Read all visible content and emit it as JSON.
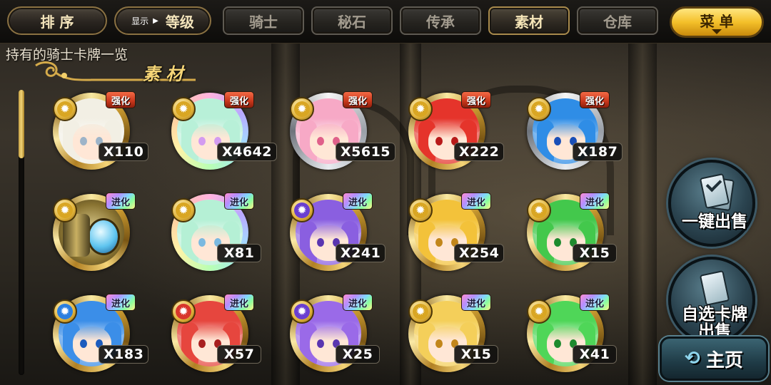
{
  "toolbar": {
    "sort_label": "排 序",
    "display_prefix": "显示",
    "display_value": "等级",
    "menu_label": "菜 单"
  },
  "tabs": [
    {
      "label": "骑士",
      "active": false
    },
    {
      "label": "秘石",
      "active": false
    },
    {
      "label": "传承",
      "active": false
    },
    {
      "label": "素材",
      "active": true
    },
    {
      "label": "仓库",
      "active": false
    }
  ],
  "page_title": "持有的骑士卡牌一览",
  "category_label": "素 材",
  "badges": {
    "strengthen": "强化",
    "evolve": "进化"
  },
  "cards": [
    {
      "badge": "强化",
      "count": "X110",
      "element": "light",
      "hair": "#f2efe4",
      "eye": "#9db4c8",
      "ring": "gold"
    },
    {
      "badge": "强化",
      "count": "X4642",
      "element": "light",
      "hair": "#b8f0d8",
      "eye": "#d39bf0",
      "ring": "rainbow"
    },
    {
      "badge": "强化",
      "count": "X5615",
      "element": "light",
      "hair": "#f7a9c6",
      "eye": "#e0608a",
      "ring": "silver"
    },
    {
      "badge": "强化",
      "count": "X222",
      "element": "light",
      "hair": "#e5342b",
      "eye": "#b81a1a",
      "ring": "gold"
    },
    {
      "badge": "强化",
      "count": "X187",
      "element": "light",
      "hair": "#2f8de6",
      "eye": "#1a4fb8",
      "ring": "silver"
    },
    {
      "badge": "进化",
      "count": "",
      "element": "light",
      "hair": "#6d5a2a",
      "eye": "#6fc7ee",
      "ring": "gold",
      "item": true
    },
    {
      "badge": "进化",
      "count": "X81",
      "element": "light",
      "hair": "#b5f0d5",
      "eye": "#7bb9e0",
      "ring": "rainbow"
    },
    {
      "badge": "进化",
      "count": "X241",
      "element": "dark",
      "hair": "#8a5fe0",
      "eye": "#5a36b0",
      "ring": "gold"
    },
    {
      "badge": "进化",
      "count": "X254",
      "element": "light",
      "hair": "#f3c23a",
      "eye": "#c2861b",
      "ring": "gold"
    },
    {
      "badge": "进化",
      "count": "X15",
      "element": "light",
      "hair": "#43c84c",
      "eye": "#1e8a2e",
      "ring": "gold"
    },
    {
      "badge": "进化",
      "count": "X183",
      "element": "water",
      "hair": "#3b8ee8",
      "eye": "#1c5bbd",
      "ring": "gold"
    },
    {
      "badge": "进化",
      "count": "X57",
      "element": "fire",
      "hair": "#e6463e",
      "eye": "#a81f1f",
      "ring": "gold"
    },
    {
      "badge": "进化",
      "count": "X25",
      "element": "dark",
      "hair": "#9a6ae8",
      "eye": "#5a36b0",
      "ring": "gold"
    },
    {
      "badge": "进化",
      "count": "X15",
      "element": "light",
      "hair": "#f4cf5a",
      "eye": "#c2861b",
      "ring": "gold"
    },
    {
      "badge": "进化",
      "count": "X41",
      "element": "light",
      "hair": "#4fd658",
      "eye": "#1e8a2e",
      "ring": "gold"
    }
  ],
  "side": {
    "quick_sell": "一键出售",
    "select_sell_line1": "自选卡牌",
    "select_sell_line2": "出售",
    "home": "主页"
  }
}
